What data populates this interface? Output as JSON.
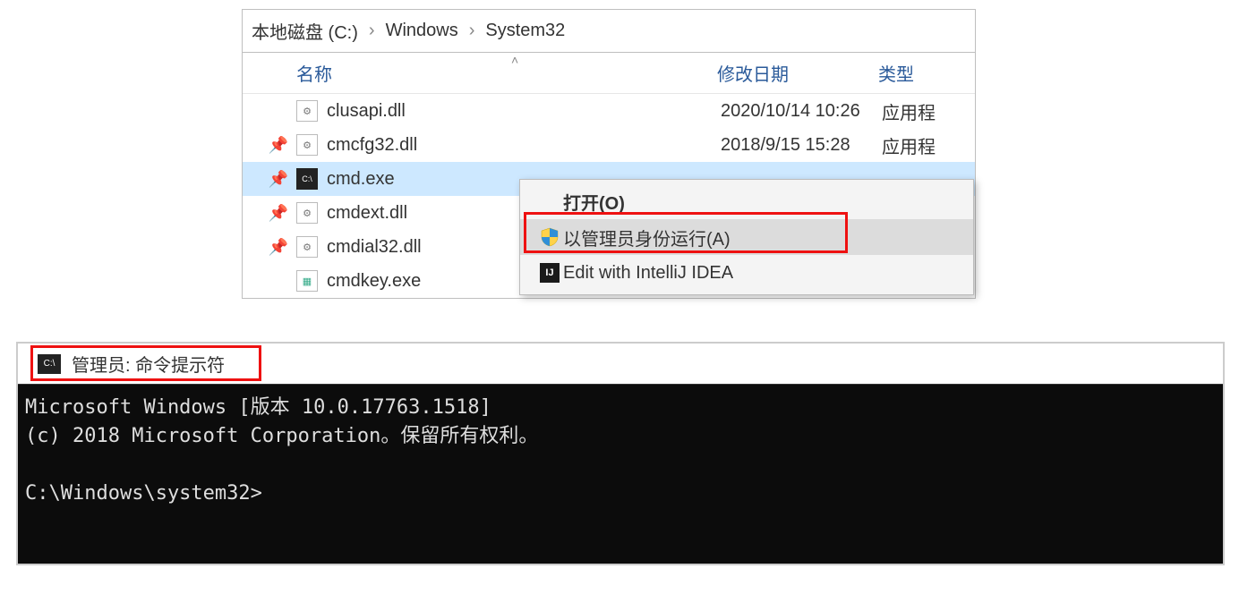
{
  "explorer": {
    "breadcrumb": {
      "root": "本地磁盘 (C:)",
      "seg1": "Windows",
      "seg2": "System32"
    },
    "columns": {
      "name": "名称",
      "date": "修改日期",
      "type": "类型"
    },
    "files": [
      {
        "name": "clusapi.dll",
        "date": "2020/10/14 10:26",
        "type": "应用程",
        "iconClass": "dll",
        "pin": false,
        "selected": false
      },
      {
        "name": "cmcfg32.dll",
        "date": "2018/9/15 15:28",
        "type": "应用程",
        "iconClass": "dll",
        "pin": true,
        "selected": false
      },
      {
        "name": "cmd.exe",
        "date": "",
        "type": "",
        "iconClass": "exe",
        "pin": true,
        "selected": true
      },
      {
        "name": "cmdext.dll",
        "date": "",
        "type": "",
        "iconClass": "dll",
        "pin": true,
        "selected": false
      },
      {
        "name": "cmdial32.dll",
        "date": "",
        "type": "",
        "iconClass": "dll",
        "pin": true,
        "selected": false
      },
      {
        "name": "cmdkey.exe",
        "date": "",
        "type": "",
        "iconClass": "key",
        "pin": false,
        "selected": false
      }
    ]
  },
  "contextMenu": {
    "open": "打开(O)",
    "runas": "以管理员身份运行(A)",
    "intellij": "Edit with IntelliJ IDEA"
  },
  "terminal": {
    "title": "管理员: 命令提示符",
    "line1": "Microsoft Windows [版本 10.0.17763.1518]",
    "line2": "(c) 2018 Microsoft Corporation。保留所有权利。",
    "prompt": "C:\\Windows\\system32>"
  }
}
